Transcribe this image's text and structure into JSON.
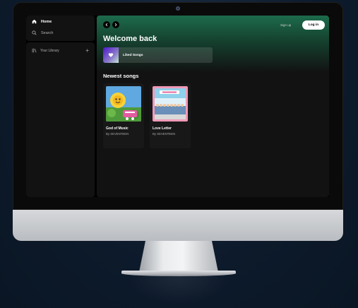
{
  "sidebar": {
    "home_label": "Home",
    "search_label": "Search",
    "library_label": "Your Library",
    "add_label": "+"
  },
  "header": {
    "signup_label": "Sign up",
    "login_label": "Log in"
  },
  "main": {
    "welcome": "Welcome back",
    "liked_songs_label": "Liked Songs",
    "section_title": "Newest songs",
    "cards": [
      {
        "title": "God of Music",
        "subtitle": "By SEVENTEEN"
      },
      {
        "title": "Love Letter",
        "subtitle": "By SEVENTEEN"
      }
    ]
  },
  "colors": {
    "accent_green": "#1d6b4c",
    "login_bg": "#ffffff",
    "panel_bg": "#121212"
  },
  "icons": [
    "home-icon",
    "search-icon",
    "library-icon",
    "chevron-left-icon",
    "chevron-right-icon",
    "heart-icon"
  ]
}
